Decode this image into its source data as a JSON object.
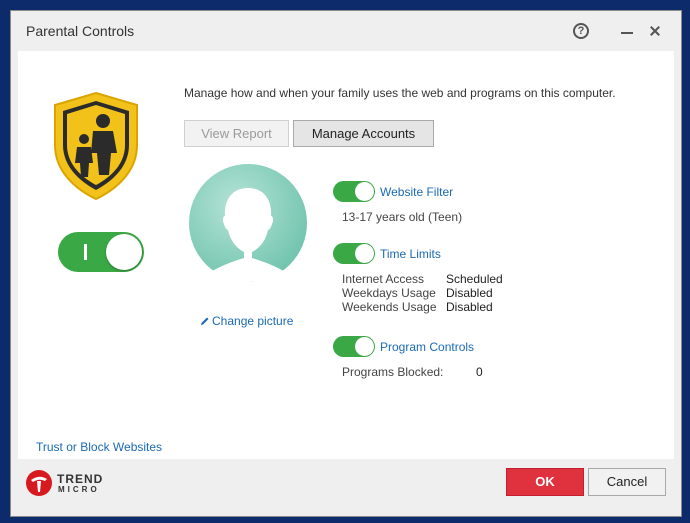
{
  "window": {
    "title": "Parental Controls"
  },
  "header": {
    "intro": "Manage how and when your family uses the web and programs on this computer.",
    "view_report": "View Report",
    "manage_accounts": "Manage Accounts"
  },
  "sidebar": {
    "main_toggle_label": "I",
    "trust_link": "Trust or Block Websites"
  },
  "profile": {
    "change_picture": "Change picture"
  },
  "features": {
    "website_filter": {
      "label": "Website Filter",
      "enabled": true,
      "detail": "13-17 years old (Teen)"
    },
    "time_limits": {
      "label": "Time Limits",
      "enabled": true,
      "rows": [
        {
          "name": "Internet Access",
          "value": "Scheduled"
        },
        {
          "name": "Weekdays Usage",
          "value": "Disabled"
        },
        {
          "name": "Weekends Usage",
          "value": "Disabled"
        }
      ]
    },
    "program_controls": {
      "label": "Program Controls",
      "enabled": true,
      "rows": [
        {
          "name": "Programs Blocked:",
          "value": "0"
        }
      ]
    }
  },
  "footer": {
    "brand_line1": "TREND",
    "brand_line2": "MICRO",
    "ok": "OK",
    "cancel": "Cancel"
  },
  "colors": {
    "toggle_on": "#3aa845",
    "link": "#1a6ab4",
    "ok_button": "#e0313f",
    "shield": "#f2c21b"
  }
}
